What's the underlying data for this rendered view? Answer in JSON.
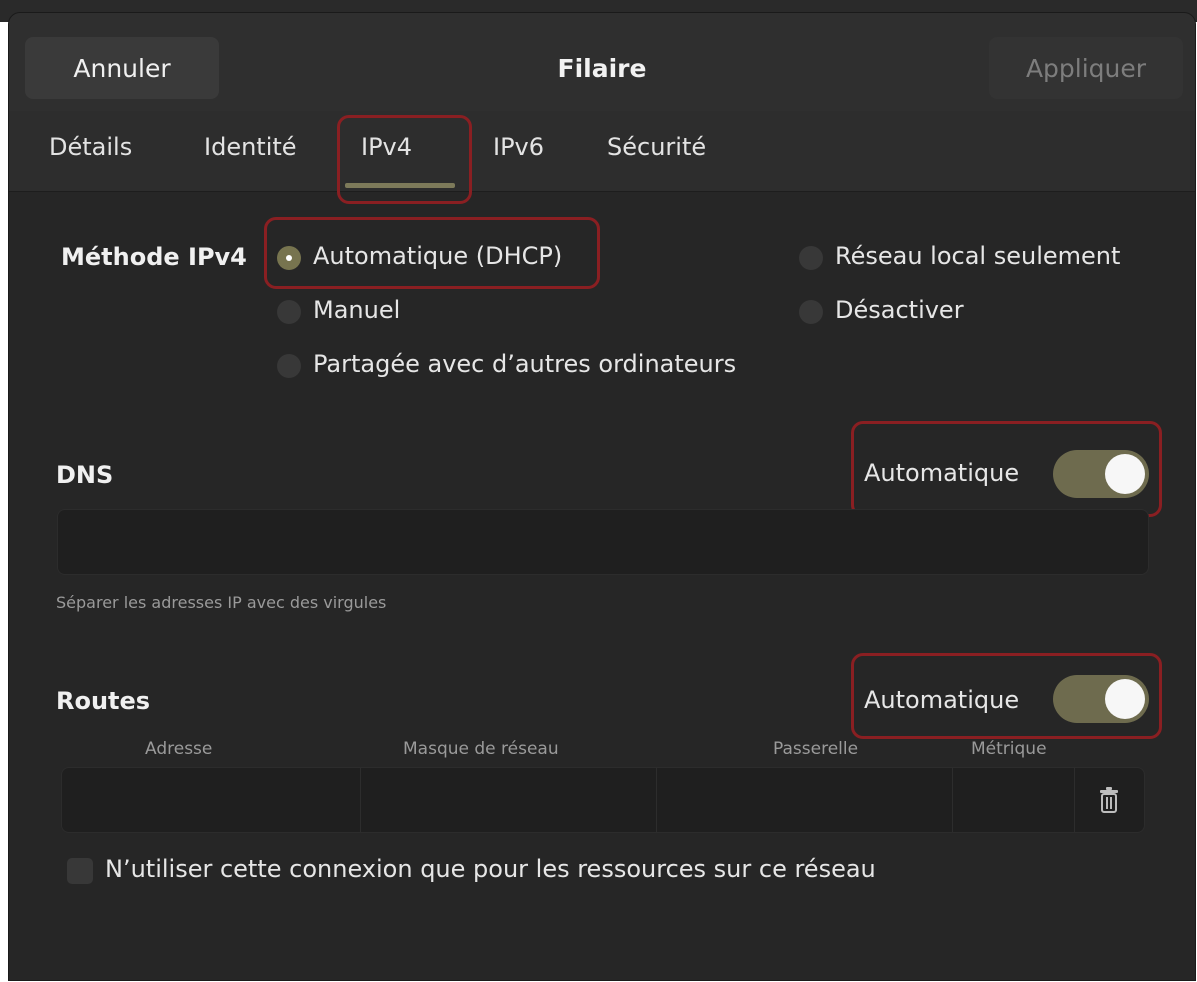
{
  "header": {
    "cancel_label": "Annuler",
    "title": "Filaire",
    "apply_label": "Appliquer"
  },
  "tabs": [
    {
      "label": "Détails"
    },
    {
      "label": "Identité"
    },
    {
      "label": "IPv4",
      "active": true
    },
    {
      "label": "IPv6"
    },
    {
      "label": "Sécurité"
    }
  ],
  "ipv4_method": {
    "label": "Méthode IPv4",
    "options": [
      {
        "label": "Automatique (DHCP)",
        "checked": true
      },
      {
        "label": "Réseau local seulement",
        "checked": false
      },
      {
        "label": "Manuel",
        "checked": false
      },
      {
        "label": "Désactiver",
        "checked": false
      },
      {
        "label": "Partagée avec d’autres ordinateurs",
        "checked": false
      }
    ]
  },
  "dns": {
    "label": "DNS",
    "automatic_label": "Automatique",
    "automatic_on": true,
    "value": "",
    "hint": "Séparer les adresses IP avec des virgules"
  },
  "routes": {
    "label": "Routes",
    "automatic_label": "Automatique",
    "automatic_on": true,
    "columns": [
      "Adresse",
      "Masque de réseau",
      "Passerelle",
      "Métrique"
    ],
    "rows": [
      {
        "address": "",
        "netmask": "",
        "gateway": "",
        "metric": ""
      }
    ]
  },
  "only_local": {
    "label": "N’utiliser cette connexion que pour les ressources sur ce réseau",
    "checked": false
  },
  "colors": {
    "accent": "#77744f",
    "highlight": "#8a1f22",
    "background": "#262626"
  },
  "icons": [
    "trash-icon"
  ]
}
